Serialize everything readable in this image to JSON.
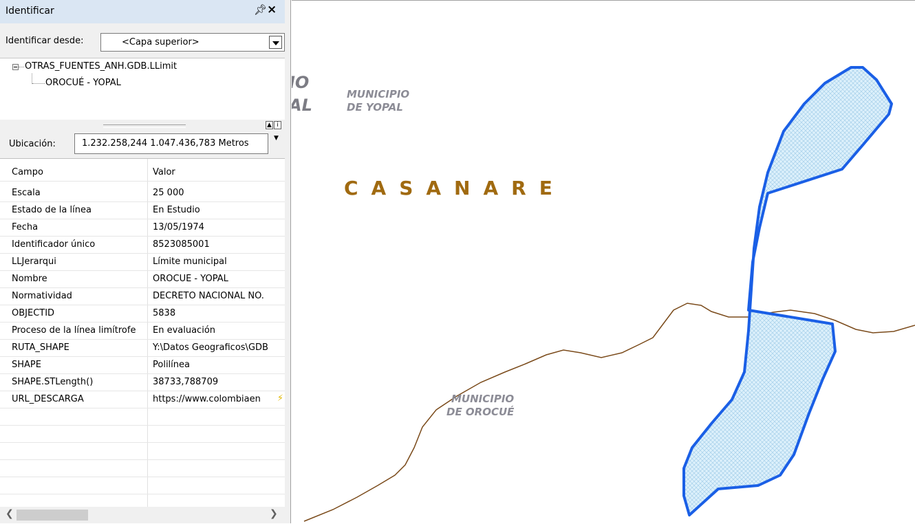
{
  "panel": {
    "title": "Identificar",
    "pin_icon": "Ȩ",
    "close_icon": "✕",
    "identify_from_label": "Identificar desde:",
    "identify_from_value": "<Capa superior>",
    "layer_name": "OTRAS_FUENTES_ANH.GDB.LLimit",
    "feature_name": "OROCUÉ - YOPAL",
    "location_label": "Ubicación:",
    "location_value": "1.232.258,244  1.047.436,783 Metros"
  },
  "attributes": {
    "headers": [
      "Campo",
      "Valor"
    ],
    "rows": [
      [
        "Escala",
        "25 000"
      ],
      [
        "Estado de la línea",
        "En Estudio"
      ],
      [
        "Fecha",
        "13/05/1974"
      ],
      [
        "Identificador único",
        "8523085001"
      ],
      [
        "LLJerarqui",
        "Límite municipal"
      ],
      [
        "Nombre",
        "OROCUÉ - YOPAL"
      ],
      [
        "Normatividad",
        "DECRETO NACIONAL NO."
      ],
      [
        "OBJECTID",
        "5838"
      ],
      [
        "Proceso de la línea limítrofe",
        "En evaluación"
      ],
      [
        "RUTA_SHAPE",
        "Y:\\Datos Geograficos\\GDB"
      ],
      [
        "SHAPE",
        "Polilínea"
      ],
      [
        "SHAPE.STLength()",
        "38733,788709"
      ],
      [
        "URL_DESCARGA",
        "https://www.colombiaen"
      ]
    ]
  },
  "map": {
    "label_partial_1": "IO",
    "label_partial_2": "AL",
    "municipio_yopal_1": "MUNICIPIO",
    "municipio_yopal_2": "DE YOPAL",
    "department": "CASANARE",
    "municipio_orocue_1": "MUNICIPIO",
    "municipio_orocue_2": "DE OROCUÉ",
    "colors": {
      "highlight_outline": "#1a5fe6",
      "highlight_fill": "#d8eefa",
      "boundary_line": "#7a4a1a",
      "department_label": "#a06a10",
      "municipio_label": "#8c8c96"
    }
  }
}
